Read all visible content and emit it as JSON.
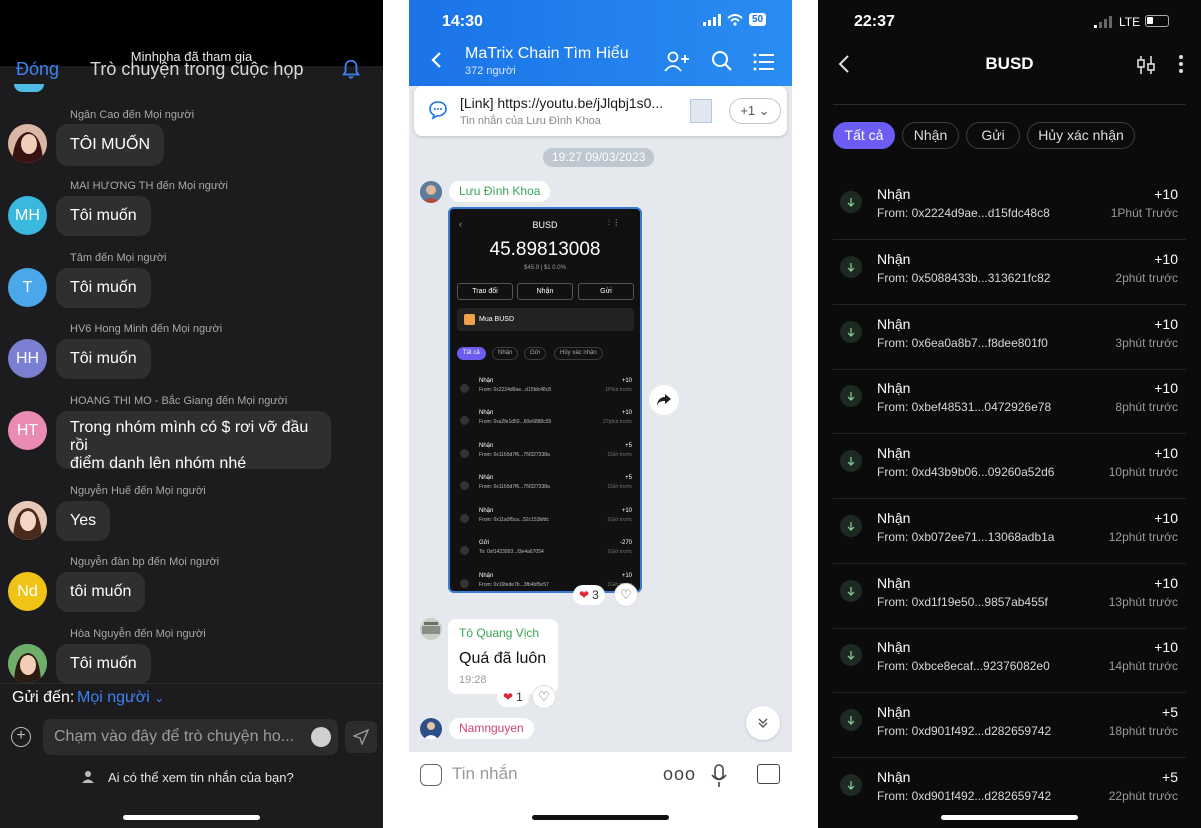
{
  "meeting": {
    "join_toast": "Minhpha đã tham gia",
    "header_left": "Đóng",
    "header_title": "Trò chuyện trong cuộc họp",
    "messages": [
      {
        "sender": "Ngân Cao đến Mọi người",
        "initials": "",
        "text": "TÔI MUỐN"
      },
      {
        "sender": "MAI HƯƠNG TH đến Mọi người",
        "initials": "MH",
        "text": "Tôi muốn"
      },
      {
        "sender": "Tâm đến Mọi người",
        "initials": "T",
        "text": "Tôi muốn"
      },
      {
        "sender": "HV6 Hong Minh đến Mọi người",
        "initials": "HH",
        "text": "Tôi muốn"
      },
      {
        "sender": "HOANG THI MO - Bắc Giang đến Mọi người",
        "initials": "HT",
        "text_line1": "Trong nhóm mình có $ rơi vỡ đầu rồi",
        "text_line2": "điểm danh lên nhóm nhé"
      },
      {
        "sender": "Nguyễn Huế đến Mọi người",
        "initials": "",
        "text": "Yes"
      },
      {
        "sender": "Nguyễn đàn bp đến Mọi người",
        "initials": "Nd",
        "text": "tôi muốn"
      },
      {
        "sender": "Hòa Nguyễn đến Mọi người",
        "initials": "",
        "text": "Tôi muốn"
      }
    ],
    "send_to_label": "Gửi đến:",
    "send_to_target": "Mọi người",
    "input_placeholder": "Chạm vào đây để trò chuyện ho...",
    "privacy_text": "Ai có thể xem tin nhắn của bạn?",
    "colors": {
      "blue": "#3b82f6",
      "mh": "#3ab8e0",
      "t": "#4aa8ea",
      "hh": "#7b7fd2",
      "ht": "#e98bb3",
      "nd": "#f2c317"
    }
  },
  "zalo": {
    "time": "14:30",
    "battery": "50",
    "group_name": "MaTrix Chain Tìm Hiểu",
    "member_count": "372 người",
    "pinned_link": "[Link] https://youtu.be/jJlqbj1s0...",
    "pinned_sub": "Tin nhắn của Lưu Đình Khoa",
    "pinned_more": "+1",
    "date_chip": "19:27 09/03/2023",
    "sender1": "Lưu Đình Khoa",
    "screenshot": {
      "title": "BUSD",
      "balance": "45.89813008",
      "usd": "$45.9 | $1 0.0%",
      "btn_swap": "Trao đổi",
      "btn_receive": "Nhận",
      "btn_send": "Gửi",
      "buy": "Mua BUSD",
      "filters": [
        "Tất cả",
        "Nhận",
        "Gửi",
        "Hủy xác nhận"
      ],
      "rows": [
        {
          "t": "Nhận",
          "f": "From: 0x2224d9ae...d15fdc48c8",
          "a": "+10",
          "w": "1Phút trước"
        },
        {
          "t": "Nhận",
          "f": "From: 0xa2fe1d50...60e6888c55",
          "a": "+10",
          "w": "27phút trước"
        },
        {
          "t": "Nhận",
          "f": "From: 0x1165d7f6...75f327338a",
          "a": "+5",
          "w": "1Giờ trước"
        },
        {
          "t": "Nhận",
          "f": "From: 0x1165d7f6...75f327338a",
          "a": "+5",
          "w": "1Giờ trước"
        },
        {
          "t": "Nhận",
          "f": "From: 0x11a0f5ca...52c153bfdc",
          "a": "+10",
          "w": "1Giờ trước"
        },
        {
          "t": "Gửi",
          "f": "To: 0xf1433993...f3e4a67054",
          "a": "-270",
          "w": "1Giờ trước"
        },
        {
          "t": "Nhận",
          "f": "From: 0x16fede7b...3fb4bf5e57",
          "a": "+10",
          "w": "1Giờ trước"
        }
      ]
    },
    "reaction1_count": "3",
    "sender2": "Tô Quang Vịch",
    "message2": "Quá đã luôn",
    "message2_time": "19:28",
    "reaction2_count": "1",
    "sender3": "Namnguyen",
    "input_placeholder": "Tin nhắn",
    "more_label": "ooo",
    "colors": {
      "header": "#1a73e8",
      "sender1": "#3aa556",
      "sender3": "#d2436e"
    }
  },
  "wallet": {
    "time": "22:37",
    "network": "LTE",
    "title": "BUSD",
    "filters": [
      "Tất cả",
      "Nhận",
      "Gửi",
      "Hủy xác nhận"
    ],
    "transactions": [
      {
        "type": "Nhận",
        "from": "From: 0x2224d9ae...d15fdc48c8",
        "amount": "+10",
        "when": "1Phút Trước"
      },
      {
        "type": "Nhận",
        "from": "From: 0x5088433b...313621fc82",
        "amount": "+10",
        "when": "2phút trước"
      },
      {
        "type": "Nhận",
        "from": "From: 0x6ea0a8b7...f8dee801f0",
        "amount": "+10",
        "when": "3phút trước"
      },
      {
        "type": "Nhận",
        "from": "From: 0xbef48531...0472926e78",
        "amount": "+10",
        "when": "8phút trước"
      },
      {
        "type": "Nhận",
        "from": "From: 0xd43b9b06...09260a52d6",
        "amount": "+10",
        "when": "10phút trước"
      },
      {
        "type": "Nhận",
        "from": "From: 0xb072ee71...13068adb1a",
        "amount": "+10",
        "when": "12phút trước"
      },
      {
        "type": "Nhận",
        "from": "From: 0xd1f19e50...9857ab455f",
        "amount": "+10",
        "when": "13phút trước"
      },
      {
        "type": "Nhận",
        "from": "From: 0xbce8ecaf...92376082e0",
        "amount": "+10",
        "when": "14phút trước"
      },
      {
        "type": "Nhận",
        "from": "From: 0xd901f492...d282659742",
        "amount": "+5",
        "when": "18phút trước"
      },
      {
        "type": "Nhận",
        "from": "From: 0xd901f492...d282659742",
        "amount": "+5",
        "when": "22phút trước"
      }
    ],
    "colors": {
      "accent": "#6b5cf6",
      "receive_icon": "#1d2a22"
    }
  }
}
